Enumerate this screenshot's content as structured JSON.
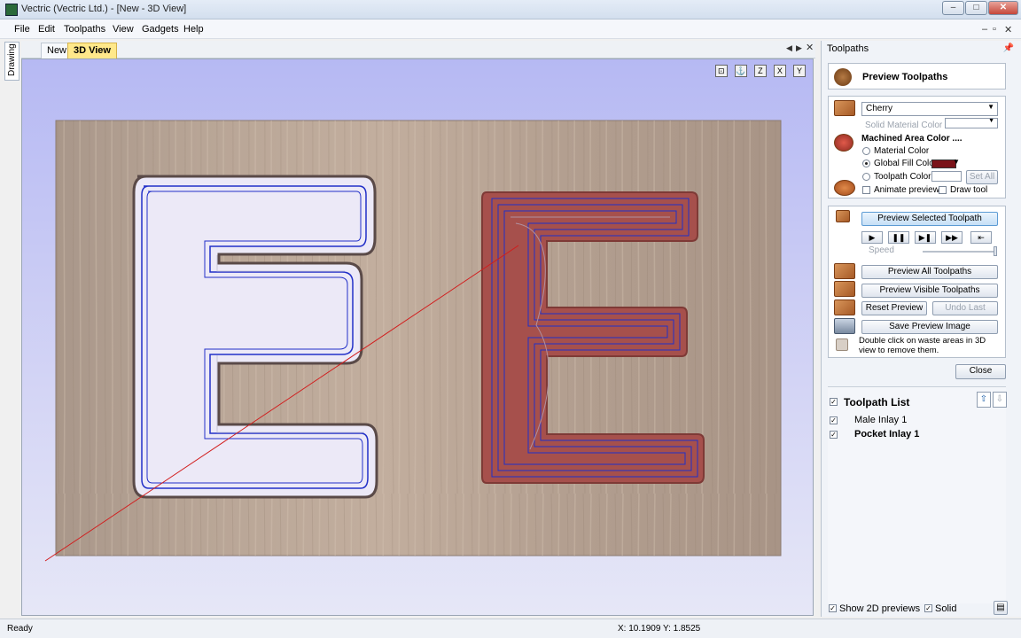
{
  "window": {
    "title": "Vectric (Vectric Ltd.) - [New - 3D View]"
  },
  "menu": [
    "File",
    "Edit",
    "Toolpaths",
    "View",
    "Gadgets",
    "Help"
  ],
  "side_tab": "Drawing",
  "doc_tabs": [
    "New",
    "3D View"
  ],
  "view_tools": [
    "fit-view-icon",
    "iso-view-icon",
    "z-view-icon",
    "x-view-icon",
    "y-view-icon"
  ],
  "panel": {
    "title": "Toolpaths",
    "header": "Preview Toolpaths",
    "material": "Cherry",
    "solid_material_color": "Solid Material Color",
    "machined_area_color": "Machined Area Color ....",
    "radio_material": "Material Color",
    "radio_global": "Global Fill Color",
    "radio_toolpath": "Toolpath Color",
    "set_all": "Set All",
    "animate_preview": "Animate preview",
    "draw_tool": "Draw tool",
    "preview_selected": "Preview Selected Toolpath",
    "speed": "Speed",
    "preview_all": "Preview All Toolpaths",
    "preview_visible": "Preview Visible Toolpaths",
    "reset_preview": "Reset Preview",
    "undo_last": "Undo Last",
    "save_preview_image": "Save Preview Image",
    "hint": "Double click on waste areas in 3D view to remove them.",
    "close": "Close",
    "global_fill_hex": "#7a1218"
  },
  "toolpath_list": {
    "title": "Toolpath List",
    "items": [
      "Male Inlay 1",
      "Pocket Inlay 1"
    ]
  },
  "footer": {
    "show_2d": "Show 2D previews",
    "solid": "Solid"
  },
  "status": {
    "left": "Ready",
    "coords": "X: 10.1909 Y:  1.8525"
  }
}
